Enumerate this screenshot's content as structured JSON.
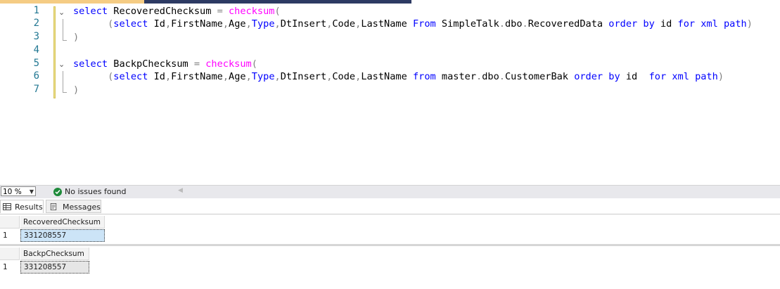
{
  "editor": {
    "line_numbers": [
      "1",
      "2",
      "3",
      "4",
      "5",
      "6",
      "7"
    ],
    "lines": [
      [
        {
          "t": "select",
          "c": "kw"
        },
        {
          "t": " RecoveredChecksum ",
          "c": "id"
        },
        {
          "t": "=",
          "c": "gr"
        },
        {
          "t": " ",
          "c": "id"
        },
        {
          "t": "checksum",
          "c": "fn"
        },
        {
          "t": "(",
          "c": "gr"
        }
      ],
      [
        {
          "t": "      ",
          "c": "id"
        },
        {
          "t": "(",
          "c": "gr"
        },
        {
          "t": "select",
          "c": "kw"
        },
        {
          "t": " Id",
          "c": "id"
        },
        {
          "t": ",",
          "c": "gr"
        },
        {
          "t": "FirstName",
          "c": "id"
        },
        {
          "t": ",",
          "c": "gr"
        },
        {
          "t": "Age",
          "c": "id"
        },
        {
          "t": ",",
          "c": "gr"
        },
        {
          "t": "Type",
          "c": "ty"
        },
        {
          "t": ",",
          "c": "gr"
        },
        {
          "t": "DtInsert",
          "c": "id"
        },
        {
          "t": ",",
          "c": "gr"
        },
        {
          "t": "Code",
          "c": "id"
        },
        {
          "t": ",",
          "c": "gr"
        },
        {
          "t": "LastName ",
          "c": "id"
        },
        {
          "t": "From",
          "c": "kw"
        },
        {
          "t": " SimpleTalk",
          "c": "id"
        },
        {
          "t": ".",
          "c": "gr"
        },
        {
          "t": "dbo",
          "c": "id"
        },
        {
          "t": ".",
          "c": "gr"
        },
        {
          "t": "RecoveredData ",
          "c": "id"
        },
        {
          "t": "order by",
          "c": "kw"
        },
        {
          "t": " id ",
          "c": "id"
        },
        {
          "t": "for xml path",
          "c": "kw"
        },
        {
          "t": ")",
          "c": "gr"
        }
      ],
      [
        {
          "t": ")",
          "c": "gr"
        }
      ],
      [],
      [
        {
          "t": "select",
          "c": "kw"
        },
        {
          "t": " BackpChecksum ",
          "c": "id"
        },
        {
          "t": "=",
          "c": "gr"
        },
        {
          "t": " ",
          "c": "id"
        },
        {
          "t": "checksum",
          "c": "fn"
        },
        {
          "t": "(",
          "c": "gr"
        }
      ],
      [
        {
          "t": "      ",
          "c": "id"
        },
        {
          "t": "(",
          "c": "gr"
        },
        {
          "t": "select",
          "c": "kw"
        },
        {
          "t": " Id",
          "c": "id"
        },
        {
          "t": ",",
          "c": "gr"
        },
        {
          "t": "FirstName",
          "c": "id"
        },
        {
          "t": ",",
          "c": "gr"
        },
        {
          "t": "Age",
          "c": "id"
        },
        {
          "t": ",",
          "c": "gr"
        },
        {
          "t": "Type",
          "c": "ty"
        },
        {
          "t": ",",
          "c": "gr"
        },
        {
          "t": "DtInsert",
          "c": "id"
        },
        {
          "t": ",",
          "c": "gr"
        },
        {
          "t": "Code",
          "c": "id"
        },
        {
          "t": ",",
          "c": "gr"
        },
        {
          "t": "LastName ",
          "c": "id"
        },
        {
          "t": "from",
          "c": "kw"
        },
        {
          "t": " master",
          "c": "id"
        },
        {
          "t": ".",
          "c": "gr"
        },
        {
          "t": "dbo",
          "c": "id"
        },
        {
          "t": ".",
          "c": "gr"
        },
        {
          "t": "CustomerBak ",
          "c": "id"
        },
        {
          "t": "order by",
          "c": "kw"
        },
        {
          "t": " id  ",
          "c": "id"
        },
        {
          "t": "for xml path",
          "c": "kw"
        },
        {
          "t": ")",
          "c": "gr"
        }
      ],
      [
        {
          "t": ")",
          "c": "gr"
        }
      ]
    ]
  },
  "statusbar": {
    "zoom": "10 %",
    "issues": "No issues found"
  },
  "results_tabs": {
    "results": "Results",
    "messages": "Messages"
  },
  "grids": [
    {
      "column": "RecoveredChecksum",
      "row_number": "1",
      "value": "331208557"
    },
    {
      "column": "BackpChecksum",
      "row_number": "1",
      "value": "331208557"
    }
  ],
  "colors": {
    "keyword": "#0000ff",
    "function": "#ff00ff",
    "operator": "#808080",
    "line_number": "#237893",
    "selected_cell": "#cce4f7"
  }
}
